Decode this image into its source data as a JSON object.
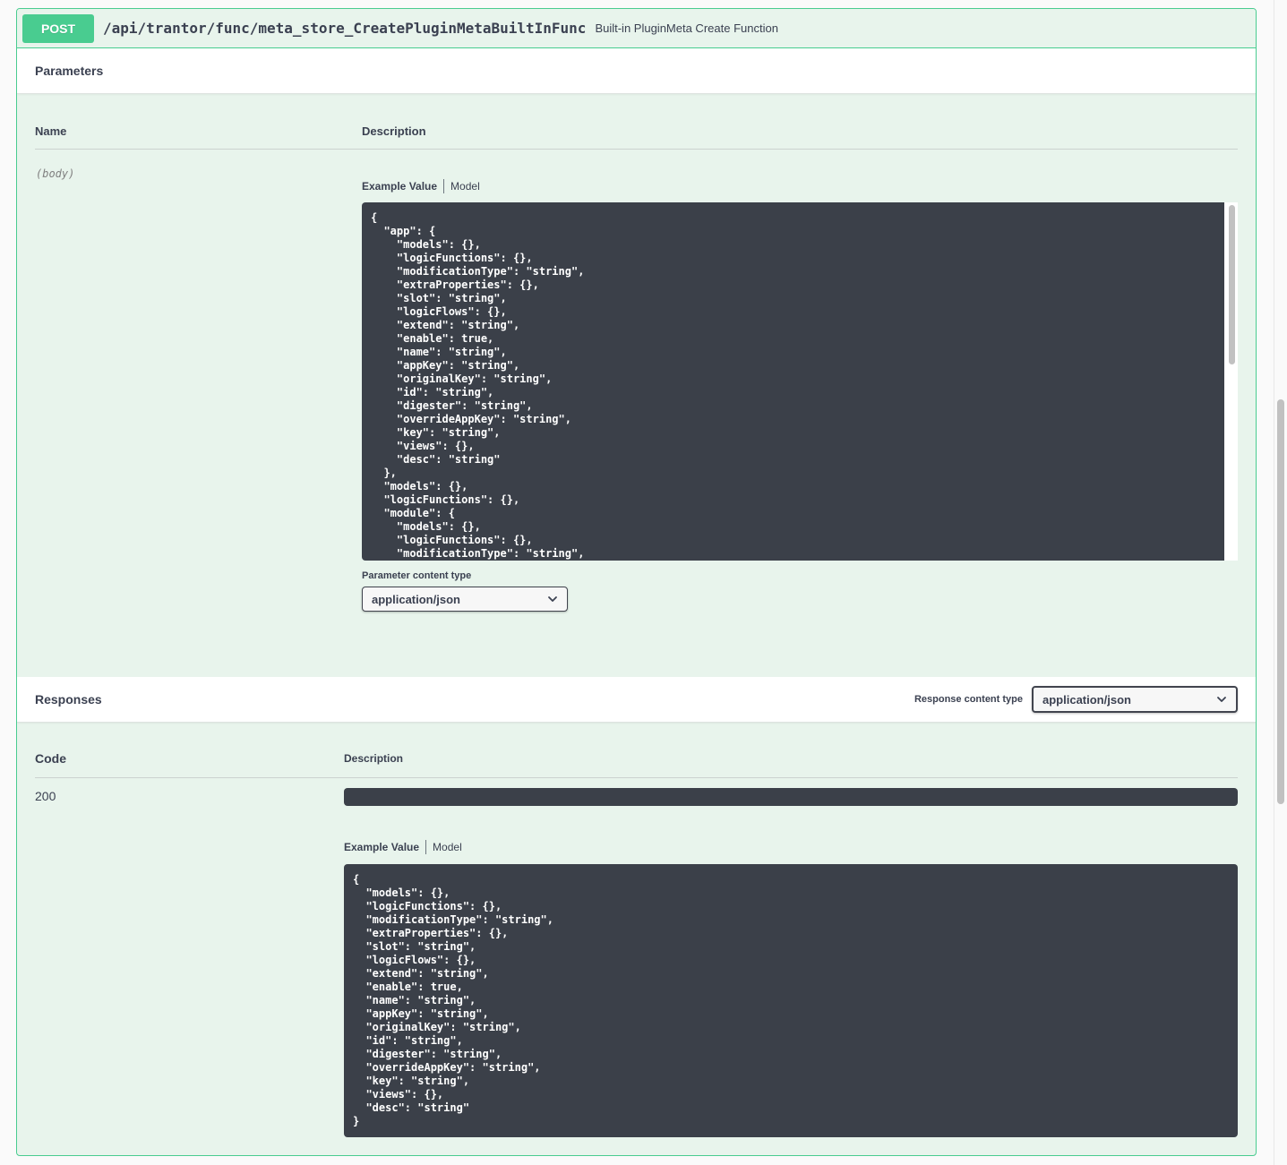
{
  "endpoint": {
    "method": "POST",
    "path": "/api/trantor/func/meta_store_CreatePluginMetaBuiltInFunc",
    "summary": "Built-in PluginMeta Create Function"
  },
  "parameters": {
    "title": "Parameters",
    "col_name": "Name",
    "col_description": "Description",
    "param_name": "(body)",
    "tab_example": "Example Value",
    "tab_model": "Model",
    "example_code": "{\n  \"app\": {\n    \"models\": {},\n    \"logicFunctions\": {},\n    \"modificationType\": \"string\",\n    \"extraProperties\": {},\n    \"slot\": \"string\",\n    \"logicFlows\": {},\n    \"extend\": \"string\",\n    \"enable\": true,\n    \"name\": \"string\",\n    \"appKey\": \"string\",\n    \"originalKey\": \"string\",\n    \"id\": \"string\",\n    \"digester\": \"string\",\n    \"overrideAppKey\": \"string\",\n    \"key\": \"string\",\n    \"views\": {},\n    \"desc\": \"string\"\n  },\n  \"models\": {},\n  \"logicFunctions\": {},\n  \"module\": {\n    \"models\": {},\n    \"logicFunctions\": {},\n    \"modificationType\": \"string\",",
    "content_type_label": "Parameter content type",
    "content_type_value": "application/json"
  },
  "responses": {
    "title": "Responses",
    "content_type_label": "Response content type",
    "content_type_value": "application/json",
    "col_code": "Code",
    "col_description": "Description",
    "code": "200",
    "tab_example": "Example Value",
    "tab_model": "Model",
    "example_code": "{\n  \"models\": {},\n  \"logicFunctions\": {},\n  \"modificationType\": \"string\",\n  \"extraProperties\": {},\n  \"slot\": \"string\",\n  \"logicFlows\": {},\n  \"extend\": \"string\",\n  \"enable\": true,\n  \"name\": \"string\",\n  \"appKey\": \"string\",\n  \"originalKey\": \"string\",\n  \"id\": \"string\",\n  \"digester\": \"string\",\n  \"overrideAppKey\": \"string\",\n  \"key\": \"string\",\n  \"views\": {},\n  \"desc\": \"string\"\n}"
  },
  "colors": {
    "post_green": "#49cc90",
    "block_bg": "#e8f4ec",
    "code_bg": "#3b4049",
    "text": "#3b4151"
  },
  "icons": {
    "select_arrow": "chevron-down-icon"
  }
}
